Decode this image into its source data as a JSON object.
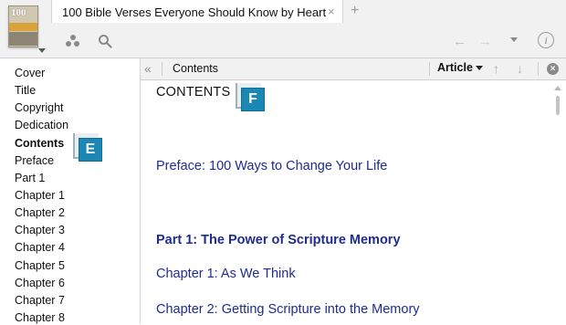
{
  "window": {
    "tab_title": "100 Bible Verses Everyone Should Know by Heart",
    "tab_close": "×",
    "tab_add": "+",
    "thumbnail_number": "100",
    "thumbnail_caption": "BIBLE VERSES"
  },
  "toolbar_icons": [
    "panels-icon",
    "search-icon",
    "back-arrow-icon",
    "forward-arrow-icon",
    "history-caret-icon",
    "info-icon"
  ],
  "sidebar": {
    "items": [
      {
        "label": "Cover"
      },
      {
        "label": "Title"
      },
      {
        "label": "Copyright"
      },
      {
        "label": "Dedication"
      },
      {
        "label": "Contents"
      },
      {
        "label": "Preface"
      },
      {
        "label": "Part 1"
      },
      {
        "label": "Chapter 1"
      },
      {
        "label": "Chapter 2"
      },
      {
        "label": "Chapter 3"
      },
      {
        "label": "Chapter 4"
      },
      {
        "label": "Chapter 5"
      },
      {
        "label": "Chapter 6"
      },
      {
        "label": "Chapter 7"
      },
      {
        "label": "Chapter 8"
      }
    ],
    "active_index": 4
  },
  "reader": {
    "collapse_label": "«",
    "title": "Contents",
    "view_label": "Article",
    "heading": "CONTENTS",
    "links": [
      {
        "text": "Preface: 100 Ways to Change Your Life",
        "bold": false
      },
      {
        "text": "Part 1: The Power of Scripture Memory",
        "bold": true
      },
      {
        "text": "Chapter 1: As We Think",
        "bold": false
      },
      {
        "text": "Chapter 2: Getting Scripture into the Memory",
        "bold": false
      }
    ]
  },
  "callouts": {
    "sidebar_badge": "E",
    "content_badge": "F"
  },
  "colors": {
    "link": "#1f2c8f",
    "badge": "#1c87b5"
  }
}
